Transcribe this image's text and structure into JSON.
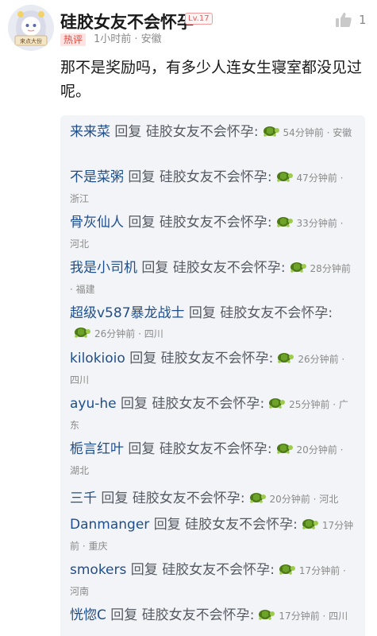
{
  "comment": {
    "username": "硅胶女友不会怀孕",
    "level": "Lv.17",
    "hot_tag": "热评",
    "time_location": "1小时前 · 安徽",
    "like_count": "1",
    "text": "那不是奖励吗，有多少人连女生寝室都没见过呢。",
    "avatar_caption": "来点大份"
  },
  "replies": [
    {
      "name": "来来菜",
      "verb": "回复",
      "target": "硅胶女友不会怀孕",
      "sep": ":",
      "time": "54分钟前 · 安徽"
    },
    {
      "name": "不是菜粥",
      "verb": "回复",
      "target": "硅胶女友不会怀孕",
      "sep": ":",
      "time": "47分钟前 · 浙江"
    },
    {
      "name": "骨灰仙人",
      "verb": "回复",
      "target": "硅胶女友不会怀孕",
      "sep": ":",
      "time": "33分钟前 · 河北"
    },
    {
      "name": "我是小司机",
      "verb": "回复",
      "target": "硅胶女友不会怀孕",
      "sep": ":",
      "time": "28分钟前 · 福建"
    },
    {
      "name": "超级v587暴龙战士",
      "verb": "回复",
      "target": "硅胶女友不会怀孕",
      "sep": ":",
      "time": "26分钟前 · 四川"
    },
    {
      "name": "kilokioio",
      "verb": "回复",
      "target": "硅胶女友不会怀孕",
      "sep": ":",
      "time": "26分钟前 · 四川"
    },
    {
      "name": "ayu-he",
      "verb": "回复",
      "target": "硅胶女友不会怀孕",
      "sep": ":",
      "time": "25分钟前 · 广东"
    },
    {
      "name": "栀言红叶",
      "verb": "回复",
      "target": "硅胶女友不会怀孕",
      "sep": ":",
      "time": "20分钟前 · 湖北"
    },
    {
      "name": "三千",
      "verb": "回复",
      "target": "硅胶女友不会怀孕",
      "sep": ":",
      "time": "20分钟前 · 河北"
    },
    {
      "name": "Danmanger",
      "verb": "回复",
      "target": "硅胶女友不会怀孕",
      "sep": ":",
      "time": "17分钟前 · 重庆"
    },
    {
      "name": "smokers",
      "verb": "回复",
      "target": "硅胶女友不会怀孕",
      "sep": ":",
      "time": "17分钟前 · 河南"
    },
    {
      "name": "恍惚C",
      "verb": "回复",
      "target": "硅胶女友不会怀孕",
      "sep": ":",
      "time": "17分钟前 · 四川"
    }
  ]
}
